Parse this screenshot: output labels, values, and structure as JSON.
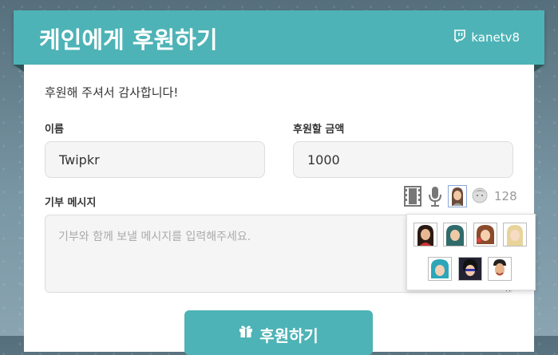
{
  "header": {
    "title": "케인에게 후원하기",
    "channel": "kanetv8"
  },
  "form": {
    "thanks": "후원해 주셔서 감사합니다!",
    "name_label": "이름",
    "name_value": "Twipkr",
    "amount_label": "후원할 금액",
    "amount_value": "1000",
    "message_label": "기부 메시지",
    "message_placeholder": "기부와 함께 보낼 메시지를 입력해주세요.",
    "media": {
      "icons": [
        "film-icon",
        "microphone-icon",
        "female-voice-avatar-icon",
        "male-voice-avatar-icon"
      ],
      "count": "128"
    },
    "submit_label": "후원하기"
  },
  "colors": {
    "accent": "#4db3b6",
    "header_text": "#ffffff"
  }
}
